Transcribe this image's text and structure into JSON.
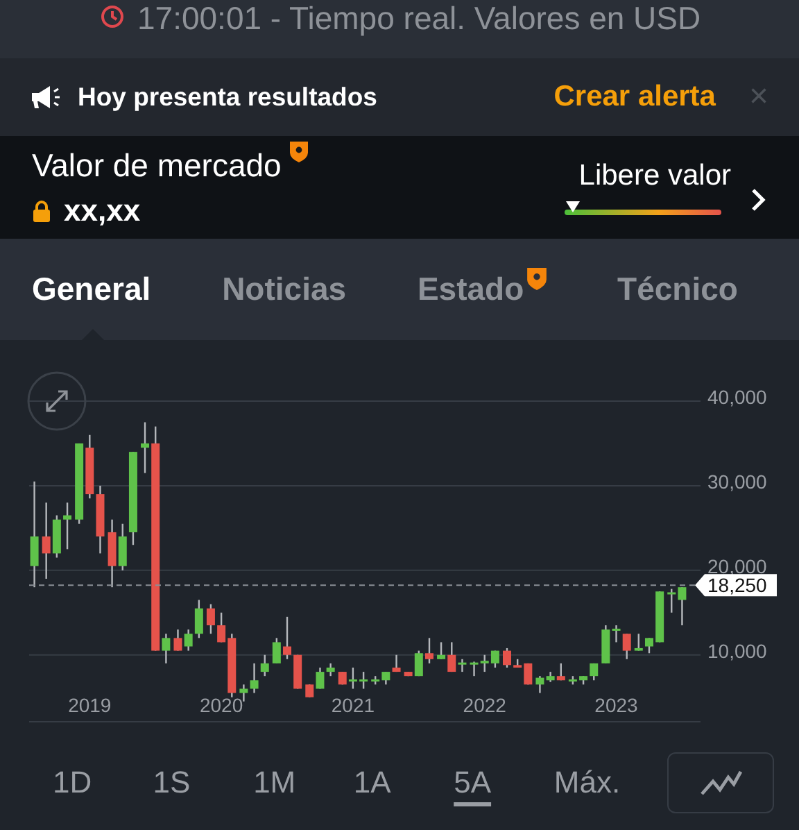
{
  "status": {
    "text": "17:00:01 - Tiempo real. Valores en USD"
  },
  "banner": {
    "text": "Hoy presenta resultados",
    "action": "Crear alerta",
    "close": "×"
  },
  "market": {
    "label": "Valor de mercado",
    "premium": true,
    "locked": true,
    "value": "xx,xx",
    "gauge_label": "Libere valor",
    "level": 0.05
  },
  "tabs": [
    {
      "label": "General",
      "selected": true,
      "premium": false
    },
    {
      "label": "Noticias",
      "selected": false,
      "premium": false
    },
    {
      "label": "Estado",
      "selected": false,
      "premium": true
    },
    {
      "label": "Técnico",
      "selected": false,
      "premium": false
    }
  ],
  "chart": {
    "chart_data": {
      "type": "candlestick",
      "grid": true,
      "ref_lines": [
        {
          "axis": "y",
          "value": 18250,
          "label": "18,250"
        }
      ],
      "x": [
        2018.58,
        2018.67,
        2018.75,
        2018.83,
        2018.92,
        2019.0,
        2019.08,
        2019.17,
        2019.25,
        2019.33,
        2019.42,
        2019.5,
        2019.58,
        2019.67,
        2019.75,
        2019.83,
        2019.92,
        2020.0,
        2020.08,
        2020.17,
        2020.25,
        2020.33,
        2020.42,
        2020.5,
        2020.58,
        2020.67,
        2020.75,
        2020.83,
        2020.92,
        2021.0,
        2021.08,
        2021.17,
        2021.25,
        2021.33,
        2021.42,
        2021.5,
        2021.58,
        2021.67,
        2021.75,
        2021.83,
        2021.92,
        2022.0,
        2022.08,
        2022.17,
        2022.25,
        2022.33,
        2022.42,
        2022.5,
        2022.58,
        2022.67,
        2022.75,
        2022.83,
        2022.92,
        2023.0,
        2023.08,
        2023.17,
        2023.25,
        2023.33,
        2023.42,
        2023.5
      ],
      "xlim": [
        2018.54,
        2023.64
      ],
      "ylim": [
        2100,
        40000
      ],
      "ohlc": [
        [
          20500,
          30500,
          18000,
          24000
        ],
        [
          24000,
          28000,
          19000,
          22000
        ],
        [
          22000,
          26500,
          21500,
          26000
        ],
        [
          26000,
          28000,
          22500,
          26500
        ],
        [
          26000,
          35000,
          25500,
          35000
        ],
        [
          34500,
          36000,
          28500,
          29000
        ],
        [
          29000,
          30000,
          22000,
          24000
        ],
        [
          24500,
          26000,
          18000,
          20500
        ],
        [
          20500,
          25500,
          20000,
          24000
        ],
        [
          24500,
          34000,
          23000,
          34000
        ],
        [
          34500,
          37500,
          31500,
          35000
        ],
        [
          35000,
          37000,
          10500,
          10500
        ],
        [
          10500,
          12500,
          9000,
          12000
        ],
        [
          12000,
          13000,
          10500,
          10500
        ],
        [
          11000,
          13000,
          10500,
          12500
        ],
        [
          12500,
          16500,
          12000,
          15500
        ],
        [
          15500,
          16000,
          12500,
          13500
        ],
        [
          13500,
          15000,
          11500,
          11500
        ],
        [
          12000,
          12500,
          5000,
          5500
        ],
        [
          5500,
          6500,
          4500,
          6000
        ],
        [
          6000,
          9000,
          5500,
          7000
        ],
        [
          8000,
          10000,
          7500,
          9000
        ],
        [
          9000,
          12000,
          9000,
          11500
        ],
        [
          11000,
          14500,
          9500,
          10000
        ],
        [
          10000,
          10000,
          6000,
          6000
        ],
        [
          6500,
          6500,
          5000,
          5000
        ],
        [
          6000,
          8500,
          6000,
          8000
        ],
        [
          8000,
          9000,
          7500,
          8500
        ],
        [
          8000,
          8000,
          6500,
          6500
        ],
        [
          7000,
          8500,
          6000,
          7100
        ],
        [
          7000,
          8000,
          6000,
          7100
        ],
        [
          7000,
          7500,
          6500,
          7100
        ],
        [
          7000,
          8000,
          6500,
          8000
        ],
        [
          8500,
          10000,
          8000,
          8000
        ],
        [
          8000,
          8000,
          7500,
          7500
        ],
        [
          7500,
          10500,
          7500,
          10200
        ],
        [
          10200,
          12000,
          9000,
          9500
        ],
        [
          9500,
          11500,
          9500,
          10000
        ],
        [
          10000,
          11500,
          8000,
          8000
        ],
        [
          9000,
          9500,
          8000,
          9100
        ],
        [
          9000,
          9200,
          7500,
          9100
        ],
        [
          9000,
          10000,
          8000,
          9300
        ],
        [
          9000,
          10500,
          8500,
          10500
        ],
        [
          10500,
          10800,
          8500,
          8800
        ],
        [
          8800,
          9500,
          8500,
          8500
        ],
        [
          9000,
          9000,
          6500,
          6500
        ],
        [
          6500,
          7500,
          5500,
          7300
        ],
        [
          7000,
          8000,
          6800,
          7500
        ],
        [
          7500,
          9000,
          7000,
          7000
        ],
        [
          7000,
          7500,
          6500,
          7100
        ],
        [
          7000,
          7500,
          6500,
          7500
        ],
        [
          7500,
          9000,
          7000,
          9000
        ],
        [
          9000,
          13500,
          9000,
          13000
        ],
        [
          13000,
          13500,
          11500,
          13100
        ],
        [
          12500,
          12500,
          9500,
          10500
        ],
        [
          10500,
          12500,
          10500,
          10800
        ],
        [
          11000,
          12000,
          10200,
          12000
        ],
        [
          11500,
          17500,
          11500,
          17500
        ],
        [
          17300,
          17800,
          15000,
          17400
        ],
        [
          16500,
          18000,
          13500,
          18000
        ]
      ],
      "yticks": [
        {
          "value": 40000,
          "label": "40,000"
        },
        {
          "value": 30000,
          "label": "30,000"
        },
        {
          "value": 20000,
          "label": "20,000"
        },
        {
          "value": 10000,
          "label": "10,000"
        }
      ],
      "xticks": [
        {
          "value": 2019,
          "label": "2019"
        },
        {
          "value": 2020,
          "label": "2020"
        },
        {
          "value": 2021,
          "label": "2021"
        },
        {
          "value": 2022,
          "label": "2022"
        },
        {
          "value": 2023,
          "label": "2023"
        }
      ]
    }
  },
  "ranges": [
    {
      "label": "1D",
      "selected": false
    },
    {
      "label": "1S",
      "selected": false
    },
    {
      "label": "1M",
      "selected": false
    },
    {
      "label": "1A",
      "selected": false
    },
    {
      "label": "5A",
      "selected": true
    },
    {
      "label": "Máx.",
      "selected": false
    }
  ]
}
